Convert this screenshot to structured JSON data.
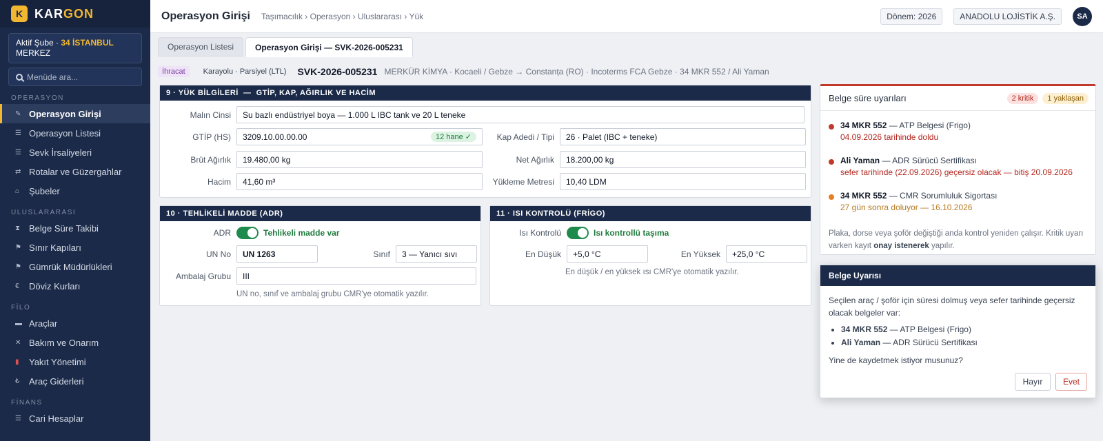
{
  "brand": {
    "logo": "K",
    "name_a": "KAR",
    "name_b": "GON"
  },
  "branch": {
    "prefix": "Aktif Şube ·",
    "code": "34 İSTANBUL",
    "suffix": "MERKEZ"
  },
  "search": {
    "placeholder": "Menüde ara..."
  },
  "sidebar": {
    "operasyon": {
      "title": "OPERASYON",
      "items": [
        "Operasyon Girişi",
        "Operasyon Listesi",
        "Sevk İrsaliyeleri",
        "Rotalar ve Güzergahlar",
        "Şubeler"
      ]
    },
    "uluslararasi": {
      "title": "ULUSLARARASI",
      "items": [
        "Belge Süre Takibi",
        "Sınır Kapıları",
        "Gümrük Müdürlükleri",
        "Döviz Kurları"
      ]
    },
    "filo": {
      "title": "FİLO",
      "items": [
        "Araçlar",
        "Bakım ve Onarım",
        "Yakıt Yönetimi",
        "Araç Giderleri"
      ]
    },
    "finans": {
      "title": "FİNANS",
      "items": [
        "Cari Hesaplar"
      ]
    }
  },
  "topbar": {
    "title": "Operasyon Girişi",
    "breadcrumb": "Taşımacılık › Operasyon › Uluslararası › Yük",
    "period": "Dönem: 2026",
    "company": "ANADOLU LOJİSTİK A.Ş.",
    "avatar": "SA"
  },
  "tabs": [
    "Operasyon Listesi",
    "Operasyon Girişi — SVK-2026-005231"
  ],
  "info": {
    "badge": "İhracat",
    "mode": "Karayolu · Parsiyel (LTL)",
    "code": "SVK-2026-005231",
    "details": "MERKÜR KİMYA · Kocaeli / Gebze → Constanța (RO) · Incoterms FCA Gebze · 34 MKR 552 / Ali Yaman"
  },
  "cargo": {
    "title": "9 · YÜK BİLGİLERİ  —  GTİP, KAP, AĞIRLIK VE HACİM",
    "malin_cinsi_label": "Malın Cinsi",
    "malin_cinsi": "Su bazlı endüstriyel boya — 1.000 L IBC tank ve 20 L teneke",
    "gtip_label": "GTİP (HS)",
    "gtip": "3209.10.00.00.00",
    "gtip_check": "12 hane ✓",
    "kap_label": "Kap Adedi / Tipi",
    "kap": "26 · Palet (IBC + teneke)",
    "brut_label": "Brüt Ağırlık",
    "brut": "19.480,00 kg",
    "net_label": "Net Ağırlık",
    "net": "18.200,00 kg",
    "hacim_label": "Hacim",
    "hacim": "41,60 m³",
    "ldm_label": "Yükleme Metresi",
    "ldm": "10,40 LDM"
  },
  "adr": {
    "title": "10 · TEHLİKELİ MADDE (ADR)",
    "adr_label": "ADR",
    "adr_state": "Tehlikeli madde var",
    "un_label": "UN No",
    "un": "UN 1263",
    "sinif_label": "Sınıf",
    "sinif": "3 — Yanıcı sıvı",
    "ambalaj_label": "Ambalaj Grubu",
    "ambalaj": "III",
    "note": "UN no, sınıf ve ambalaj grubu CMR'ye otomatik yazılır."
  },
  "frigo": {
    "title": "11 · ISI KONTROLÜ (FRİGO)",
    "label": "Isı Kontrolü",
    "state": "Isı kontrollü taşıma",
    "min_label": "En Düşük",
    "min": "+5,0 °C",
    "max_label": "En Yüksek",
    "max": "+25,0 °C",
    "note": "En düşük / en yüksek ısı CMR'ye otomatik yazılır."
  },
  "warnings": {
    "title": "Belge süre uyarıları",
    "critical": "2 kritik",
    "upcoming": "1 yaklaşan",
    "items": [
      {
        "who": "34 MKR 552",
        "what": " — ATP Belgesi (Frigo)",
        "detail": "04.09.2026 tarihinde doldu",
        "color": "#c0392b",
        "detail_color": "#b3261e"
      },
      {
        "who": "Ali Yaman",
        "what": " — ADR Sürücü Sertifikası",
        "detail": "sefer tarihinde (22.09.2026) geçersiz olacak — bitiş 20.09.2026",
        "color": "#c0392b",
        "detail_color": "#b3261e"
      },
      {
        "who": "34 MKR 552",
        "what": " — CMR Sorumluluk Sigortası",
        "detail": "27 gün sonra doluyor — 16.10.2026",
        "color": "#e67e22",
        "detail_color": "#b7791f"
      }
    ],
    "footer_a": "Plaka, dorse veya şoför değiştiği anda kontrol yeniden çalışır. Kritik uyarı varken kayıt ",
    "footer_b": "onay istenerek",
    "footer_c": " yapılır."
  },
  "dialog": {
    "title": "Belge Uyarısı",
    "text": "Seçilen araç / şoför için süresi dolmuş veya sefer tarihinde geçersiz olacak belgeler var:",
    "items": [
      {
        "who": "34 MKR 552",
        "what": " — ATP Belgesi (Frigo)"
      },
      {
        "who": "Ali Yaman",
        "what": " — ADR Sürücü Sertifikası"
      }
    ],
    "question": "Yine de kaydetmek istiyor musunuz?",
    "no": "Hayır",
    "yes": "Evet"
  }
}
